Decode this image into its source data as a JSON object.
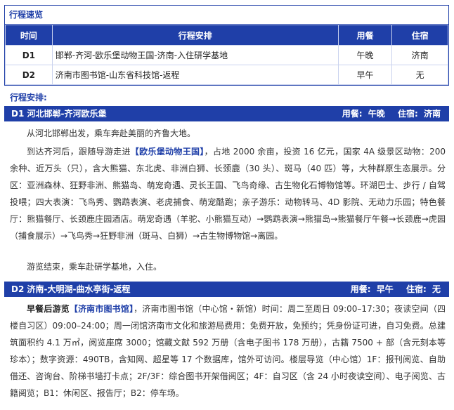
{
  "overview": {
    "title": "行程速览",
    "headers": [
      "时间",
      "行程安排",
      "用餐",
      "住宿"
    ],
    "rows": [
      {
        "day": "D1",
        "plan": "邯郸-齐河-欧乐堡动物王国-济南-入住研学基地",
        "meal": "午晚",
        "hotel": "济南"
      },
      {
        "day": "D2",
        "plan": "济南市图书馆-山东省科技馆-返程",
        "meal": "早午",
        "hotel": "无"
      }
    ]
  },
  "itinerary_title": "行程安排:",
  "days": [
    {
      "title": "D1 河北邯郸-齐河欧乐堡",
      "meal_label": "用餐:",
      "meal": "午晚",
      "hotel_label": "住宿:",
      "hotel": "济南",
      "para1": "从河北邯郸出发，乘车奔赴美丽的齐鲁大地。",
      "para2_pre": "到达齐河后，跟随导游走进",
      "para2_hl": "【欧乐堡动物王国】",
      "para2_post": "，占地 2000 余亩，投资 16 亿元，国家 4A 级景区动物：200 余种、近万头（只），含大熊猫、东北虎、非洲白狮、长颈鹿（30 头）、斑马（40 匹）等，大种群原生态展示。分区：亚洲森林、狂野非洲、熊猫岛、萌宠奇遇、灵长王国、飞鸟奇缘、古生物化石博物馆等。环湖巴士、步行 / 自驾投喂；四大表演：飞鸟秀、鹦鹉表演、老虎捕食、萌宠酷跑；亲子游乐：动物转马、4D 影院、无动力乐园；特色餐厅：熊猫餐厅、长颈鹿庄园酒店。萌宠奇遇（羊驼、小熊猫互动）→鹦鹉表演→熊猫岛→熊猫餐厅午餐→长颈鹿→虎园（捕食展示）→飞鸟秀→狂野非洲（斑马、白狮）→古生物博物馆→离园。",
      "para3": "游览结束，乘车赴研学基地，入住。"
    },
    {
      "title": "D2 济南-大明湖-曲水亭街-返程",
      "meal_label": "用餐:",
      "meal": "早午",
      "hotel_label": "住宿:",
      "hotel": "无",
      "para1_bold": "早餐后游览",
      "para1_hl": "【济南市图书馆】",
      "para1_post": "，济南市图书馆（中心馆・新馆）时间：周二至周日 09:00–17:30；夜读空间（四楼自习区）09:00–24:00；周一闭馆济南市文化和旅游局费用：免费开放，免预约；凭身份证可进，自习免费。总建筑面积约 4.1 万㎡，阅览座席 3000；馆藏文献 592 万册（含电子图书 178 万册），古籍 7500 + 部（含元刻本等珍本）；数字资源：490TB，含知网、超星等 17 个数据库，馆外可访问。楼层导览（中心馆）1F：报刊阅览、自助借还、咨询台、阶梯书墙打卡点；2F/3F：综合图书开架借阅区；4F：自习区（含 24 小时夜读空间）、电子阅览、古籍阅览；B1：休闲区、报告厅；B2：停车场。"
    }
  ]
}
